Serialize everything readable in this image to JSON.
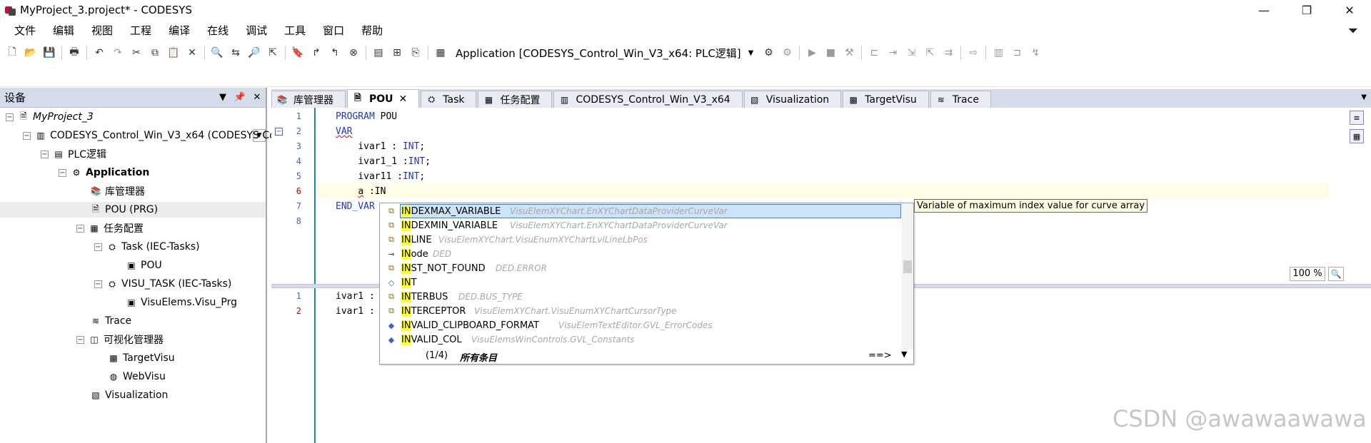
{
  "window": {
    "title": "MyProject_3.project* - CODESYS",
    "minimize": "—",
    "maximize": "❐",
    "close": "✕"
  },
  "menu": [
    "文件",
    "编辑",
    "视图",
    "工程",
    "编译",
    "在线",
    "调试",
    "工具",
    "窗口",
    "帮助"
  ],
  "toolbar": {
    "application_selector": "Application [CODESYS_Control_Win_V3_x64: PLC逻辑]"
  },
  "device_panel": {
    "title": "设备",
    "tree": [
      {
        "label": "MyProject_3",
        "style": "italic"
      },
      {
        "label": "CODESYS_Control_Win_V3_x64 (CODESYS Contr"
      },
      {
        "label": "PLC逻辑"
      },
      {
        "label": "Application",
        "style": "bold"
      },
      {
        "label": "库管理器"
      },
      {
        "label": "POU (PRG)"
      },
      {
        "label": "任务配置"
      },
      {
        "label": "Task (IEC-Tasks)"
      },
      {
        "label": "POU"
      },
      {
        "label": "VISU_TASK (IEC-Tasks)"
      },
      {
        "label": "VisuElems.Visu_Prg"
      },
      {
        "label": "Trace"
      },
      {
        "label": "可视化管理器"
      },
      {
        "label": "TargetVisu"
      },
      {
        "label": "WebVisu"
      },
      {
        "label": "Visualization"
      }
    ]
  },
  "tabs": [
    {
      "label": "库管理器",
      "active": false
    },
    {
      "label": "POU",
      "active": true
    },
    {
      "label": "Task",
      "active": false
    },
    {
      "label": "任务配置",
      "active": false
    },
    {
      "label": "CODESYS_Control_Win_V3_x64",
      "active": false
    },
    {
      "label": "Visualization",
      "active": false
    },
    {
      "label": "TargetVisu",
      "active": false
    },
    {
      "label": "Trace",
      "active": false
    }
  ],
  "editor": {
    "line_numbers": [
      "1",
      "2",
      "3",
      "4",
      "5",
      "6",
      "7",
      "8"
    ],
    "lines": [
      {
        "kw": "PROGRAM",
        "rest": " POU"
      },
      {
        "kw": "VAR",
        "rest": ""
      },
      {
        "indent": "    ",
        "name": "ivar1",
        "sep": " : ",
        "type": "INT",
        "end": ";"
      },
      {
        "indent": "    ",
        "name": "ivar1_1",
        "sep": " :",
        "type": "INT",
        "end": ";"
      },
      {
        "indent": "    ",
        "name": "ivar11",
        "sep": " :",
        "type": "INT",
        "end": ";"
      },
      {
        "indent": "    ",
        "name": "a",
        "sep": " :",
        "type": "",
        "end": "IN"
      },
      {
        "kw": "END_VAR",
        "rest": ""
      },
      {
        "kw": "",
        "rest": ""
      }
    ],
    "impl_line_numbers": [
      "1",
      "2"
    ],
    "impl_lines": [
      "ivar1 :",
      "ivar1 :"
    ],
    "zoom": "100 %"
  },
  "autocomplete": {
    "tooltip": "Variable of maximum index value for curve array",
    "items": [
      {
        "name": "INDEXMAX_VARIABLE",
        "match": "IN",
        "type": "VisuElemXYChart.EnXYChartDataProviderCurveVar",
        "icon": "var-icon",
        "selected": true
      },
      {
        "name": "INDEXMIN_VARIABLE",
        "match": "IN",
        "type": "VisuElemXYChart.EnXYChartDataProviderCurveVar",
        "icon": "var-icon"
      },
      {
        "name": "INLINE",
        "match": "IN",
        "type": "VisuElemXYChart.VisuEnumXYChartLvlLineLbPos",
        "icon": "var-icon"
      },
      {
        "name": "INode",
        "match": "IN",
        "type": "DED",
        "icon": "interface-icon"
      },
      {
        "name": "INST_NOT_FOUND",
        "match": "IN",
        "type": "DED.ERROR",
        "icon": "var-icon"
      },
      {
        "name": "INT",
        "match": "IN",
        "type": "",
        "icon": "type-icon"
      },
      {
        "name": "INTERBUS",
        "match": "IN",
        "type": "DED.BUS_TYPE",
        "icon": "var-icon"
      },
      {
        "name": "INTERCEPTOR",
        "match": "IN",
        "type": "VisuElemXYChart.VisuEnumXYChartCursorType",
        "icon": "var-icon"
      },
      {
        "name": "INVALID_CLIPBOARD_FORMAT",
        "match": "IN",
        "type": "VisuElemTextEditor.GVL_ErrorCodes",
        "icon": "const-icon"
      },
      {
        "name": "INVALID_COL",
        "match": "IN",
        "type": "VisuElemsWinControls.GVL_Constants",
        "icon": "const-icon"
      }
    ],
    "page": "(1/4)",
    "filter": "所有条目",
    "more": "==>"
  },
  "watermark": "CSDN @awawaawawa"
}
